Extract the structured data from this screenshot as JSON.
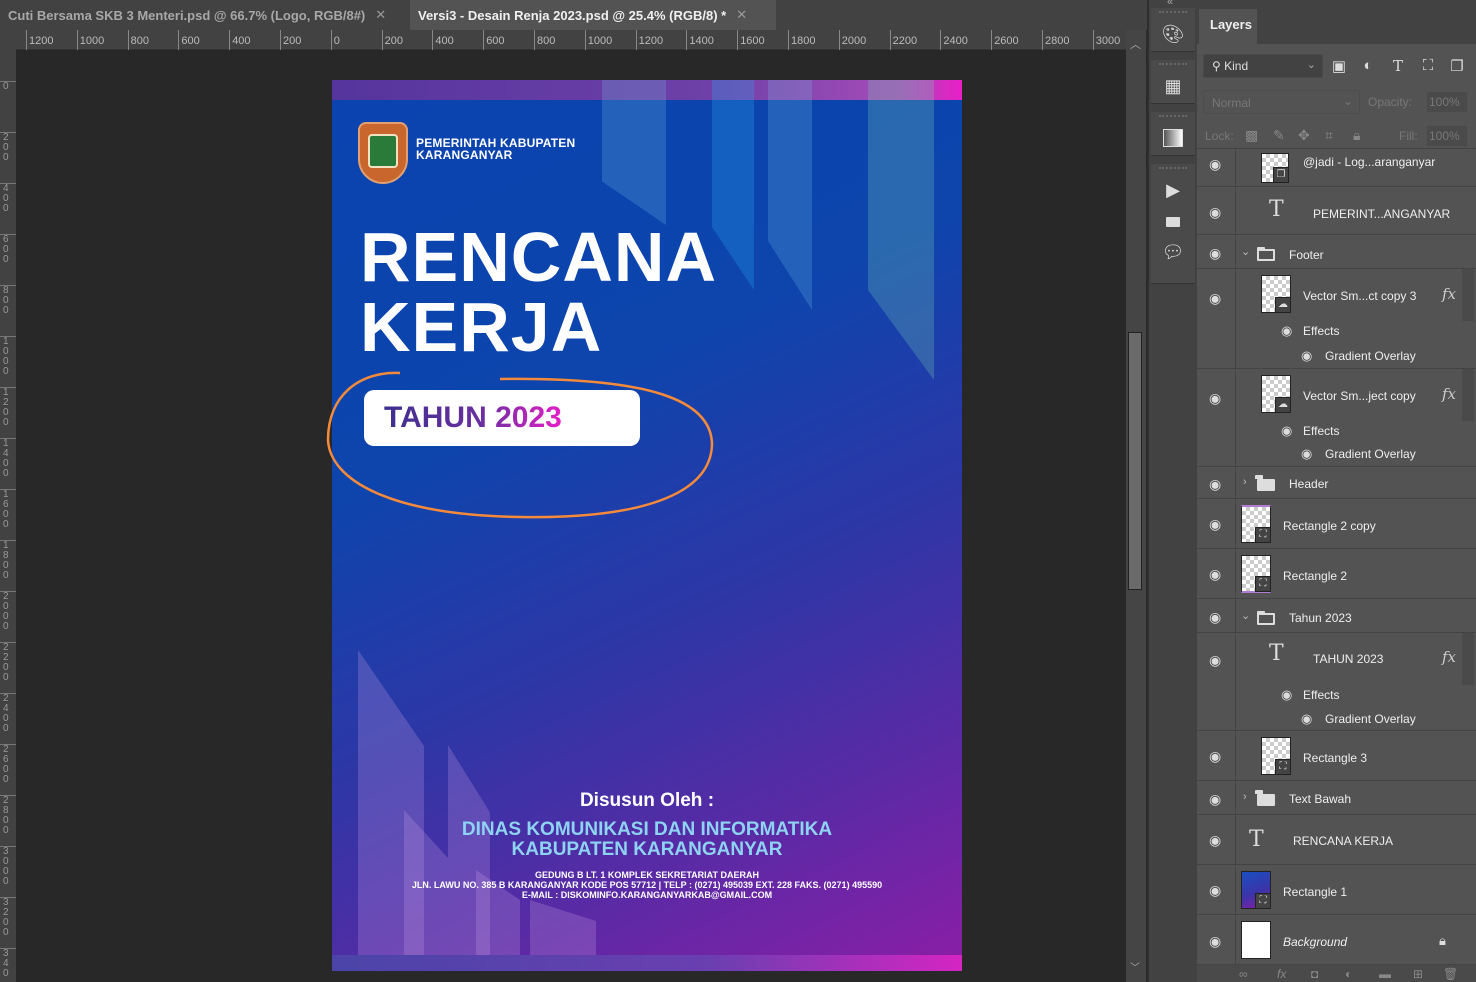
{
  "tabs": [
    {
      "label": "Cuti Bersama SKB 3 Menteri.psd @ 66.7% (Logo, RGB/8#)",
      "close": "✕",
      "active": false
    },
    {
      "label": "Versi3 - Desain Renja 2023.psd @ 25.4% (RGB/8) *",
      "close": "✕",
      "active": true
    }
  ],
  "ruler": {
    "horizontal": [
      "1200",
      "1000",
      "800",
      "600",
      "400",
      "200",
      "0",
      "200",
      "400",
      "600",
      "800",
      "1000",
      "1200",
      "1400",
      "1600",
      "1800",
      "2000",
      "2200",
      "2400",
      "2600",
      "2800",
      "3000"
    ],
    "vertical": [
      "0",
      "2\n0\n0",
      "4\n0\n0",
      "6\n0\n0",
      "8\n0\n0",
      "1\n0\n0\n0",
      "1\n2\n0\n0",
      "1\n4\n0\n0",
      "1\n6\n0\n0",
      "1\n8\n0\n0",
      "2\n0\n0\n0",
      "2\n2\n0\n0",
      "2\n4\n0\n0",
      "2\n6\n0\n0",
      "2\n8\n0\n0",
      "3\n0\n0\n0",
      "3\n2\n0\n0",
      "3\n4\n0"
    ]
  },
  "document": {
    "gov_line1": "PEMERINTAH KABUPATEN",
    "gov_line2": "KARANGANYAR",
    "title_line1": "RENCANA",
    "title_line2": "KERJA",
    "year": "TAHUN 2023",
    "byline": "Disusun Oleh :",
    "org_line1": "DINAS KOMUNIKASI DAN INFORMATIKA",
    "org_line2": "KABUPATEN KARANGANYAR",
    "addr_line1": "GEDUNG B LT. 1 KOMPLEK SEKRETARIAT DAERAH",
    "addr_line2": "JLN. LAWU NO. 385 B KARANGANYAR KODE  POS 57712 | TELP : (0271) 495039 EXT. 228 FAKS. (0271) 495590",
    "addr_line3": "E-MAIL : DISKOMINFO.KARANGANYARKAB@GMAIL.COM",
    "colors": {
      "bg_top": "#0b43b0",
      "bg_bottom": "#8b1ea6",
      "accent_magenta": "#e71fc6",
      "org_text": "#8ed3f2",
      "annotation": "#f58a3a"
    }
  },
  "toolstrip": {
    "icons": [
      "palette-icon",
      "grid-swatches-icon",
      "gradient-icon",
      "play-action-icon",
      "plugin-icon",
      "comment-icon"
    ]
  },
  "layers_panel": {
    "tab": "Layers",
    "filter_kind": "Kind",
    "blend_mode": "Normal",
    "opacity_label": "Opacity:",
    "opacity_value": "100%",
    "lock_label": "Lock:",
    "fill_label": "Fill:",
    "fill_value": "100%",
    "layers": [
      {
        "name": "@jadi - Log...aranganyar",
        "type": "smart"
      },
      {
        "name": "PEMERINT...ANGANYAR",
        "type": "text"
      },
      {
        "name": "Footer",
        "type": "group",
        "expanded": true
      },
      {
        "name": "Vector Sm...ct copy 3",
        "type": "smart-vector",
        "fx": "fx",
        "effects": "Effects",
        "effect_item": "Gradient Overlay"
      },
      {
        "name": "Vector Sm...ject copy",
        "type": "smart-vector",
        "fx": "fx",
        "effects": "Effects",
        "effect_item": "Gradient Overlay"
      },
      {
        "name": "Header",
        "type": "group",
        "expanded": false
      },
      {
        "name": "Rectangle 2 copy",
        "type": "shape"
      },
      {
        "name": "Rectangle 2",
        "type": "shape"
      },
      {
        "name": "Tahun 2023",
        "type": "group",
        "expanded": true
      },
      {
        "name": "TAHUN 2023",
        "type": "text",
        "fx": "fx",
        "effects": "Effects",
        "effect_item": "Gradient Overlay"
      },
      {
        "name": "Rectangle 3",
        "type": "shape"
      },
      {
        "name": "Text Bawah",
        "type": "group",
        "expanded": false
      },
      {
        "name": "RENCANA KERJA",
        "type": "text"
      },
      {
        "name": "Rectangle 1",
        "type": "shape-gradient"
      },
      {
        "name": "Background",
        "type": "background",
        "locked": true
      }
    ]
  }
}
